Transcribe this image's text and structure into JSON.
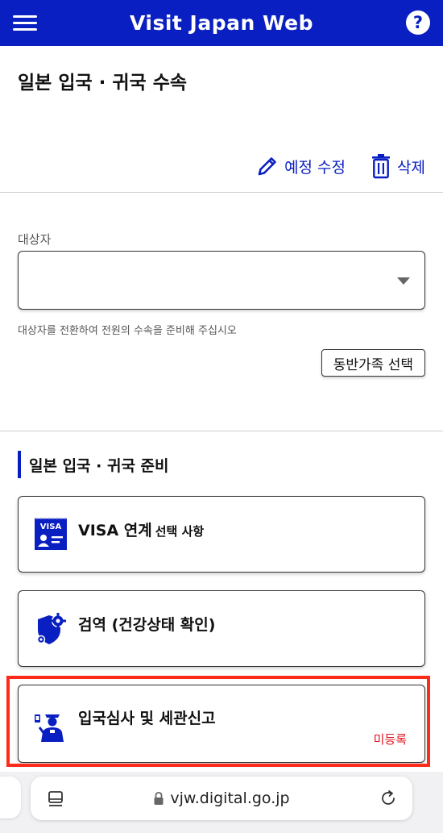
{
  "header": {
    "title": "Visit Japan Web",
    "help_label": "?"
  },
  "page": {
    "title": "일본 입국 · 귀국 수속"
  },
  "actions": {
    "edit_label": "예정 수정",
    "delete_label": "삭제"
  },
  "target": {
    "label": "대상자",
    "value": "",
    "helper": "대상자를 전환하여 전원의 수속을 준비해 주십시오",
    "family_button": "동반가족 선택"
  },
  "section": {
    "title": "일본 입국 · 귀국 준비"
  },
  "cards": [
    {
      "title": "VISA 연계",
      "subtitle": "선택 사항",
      "icon": "visa-card-icon",
      "icon_text": "VISA"
    },
    {
      "title": "검역 (건강상태 확인)",
      "icon": "quarantine-shield-gear-icon"
    },
    {
      "title": "입국심사 및 세관신고",
      "status": "미등록",
      "icon": "immigration-officer-icon"
    }
  ],
  "browser": {
    "url": "vjw.digital.go.jp"
  },
  "colors": {
    "brand": "#0a1fc1",
    "status_unregistered": "#e0161f",
    "highlight": "#ff2a1a"
  }
}
